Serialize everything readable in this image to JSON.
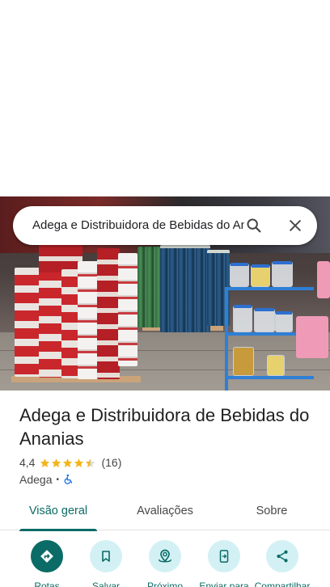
{
  "search": {
    "query": "Adega e Distribuidora de Bebidas do Ananias"
  },
  "place": {
    "name": "Adega e Distribuidora de Bebidas do Ananias",
    "rating": "4,4",
    "rating_value": 4.4,
    "reviews_count": "(16)",
    "category": "Adega",
    "separator": "•",
    "accessibility_icon": "wheelchair-icon"
  },
  "colors": {
    "accent": "#0b6b66",
    "accent_light": "#d3f1f4",
    "star": "#f3b51c"
  },
  "tabs": [
    {
      "label": "Visão geral",
      "active": true
    },
    {
      "label": "Avaliações",
      "active": false
    },
    {
      "label": "Sobre",
      "active": false
    }
  ],
  "actions": [
    {
      "label": "Rotas",
      "icon": "directions-icon"
    },
    {
      "label": "Salvar",
      "icon": "bookmark-icon"
    },
    {
      "label": "Próximo",
      "icon": "nearby-icon"
    },
    {
      "label": "Enviar para",
      "icon": "send-to-phone-icon"
    },
    {
      "label": "Compartilhar",
      "icon": "share-icon"
    }
  ]
}
